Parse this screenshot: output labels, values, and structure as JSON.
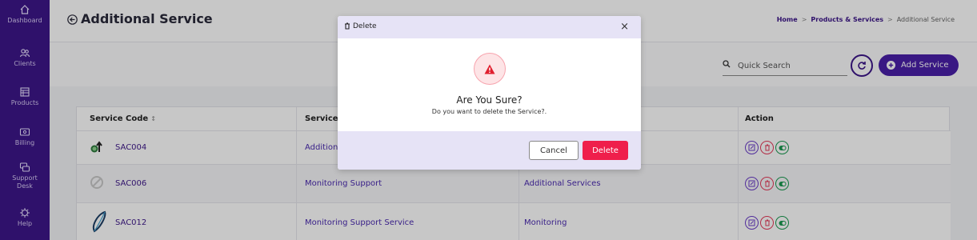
{
  "sidebar": {
    "items": [
      {
        "label": "Dashboard",
        "icon": "home-icon"
      },
      {
        "label": "Clients",
        "icon": "users-icon"
      },
      {
        "label": "Products",
        "icon": "box-icon"
      },
      {
        "label": "Billing",
        "icon": "billing-icon"
      },
      {
        "label": "Support Desk",
        "icon": "support-icon"
      },
      {
        "label": "Help",
        "icon": "help-icon"
      }
    ]
  },
  "header": {
    "title": "Additional Service",
    "breadcrumb": {
      "home": "Home",
      "section": "Products & Services",
      "current": "Additional Service",
      "separator": ">"
    }
  },
  "toolbar": {
    "search_placeholder": "Quick Search",
    "add_label": "Add Service"
  },
  "table": {
    "columns": [
      "Service Code",
      "Service N",
      "",
      "Action"
    ],
    "sort_indicator": "↕",
    "rows": [
      {
        "code": "SAC004",
        "name": "Additiona",
        "category": ""
      },
      {
        "code": "SAC006",
        "name": "Monitoring Support",
        "category": "Additional Services"
      },
      {
        "code": "SAC012",
        "name": "Monitoring Support Service",
        "category": "Monitoring"
      }
    ]
  },
  "modal": {
    "title": "Delete",
    "close": "×",
    "heading": "Are You Sure?",
    "text": "Do you want to delete the Service?.",
    "cancel_label": "Cancel",
    "delete_label": "Delete"
  },
  "colors": {
    "sidebar": "#3d1789",
    "accent": "#4a1fa8",
    "danger": "#ef1f4b",
    "modal_band": "#e6e3f6"
  }
}
